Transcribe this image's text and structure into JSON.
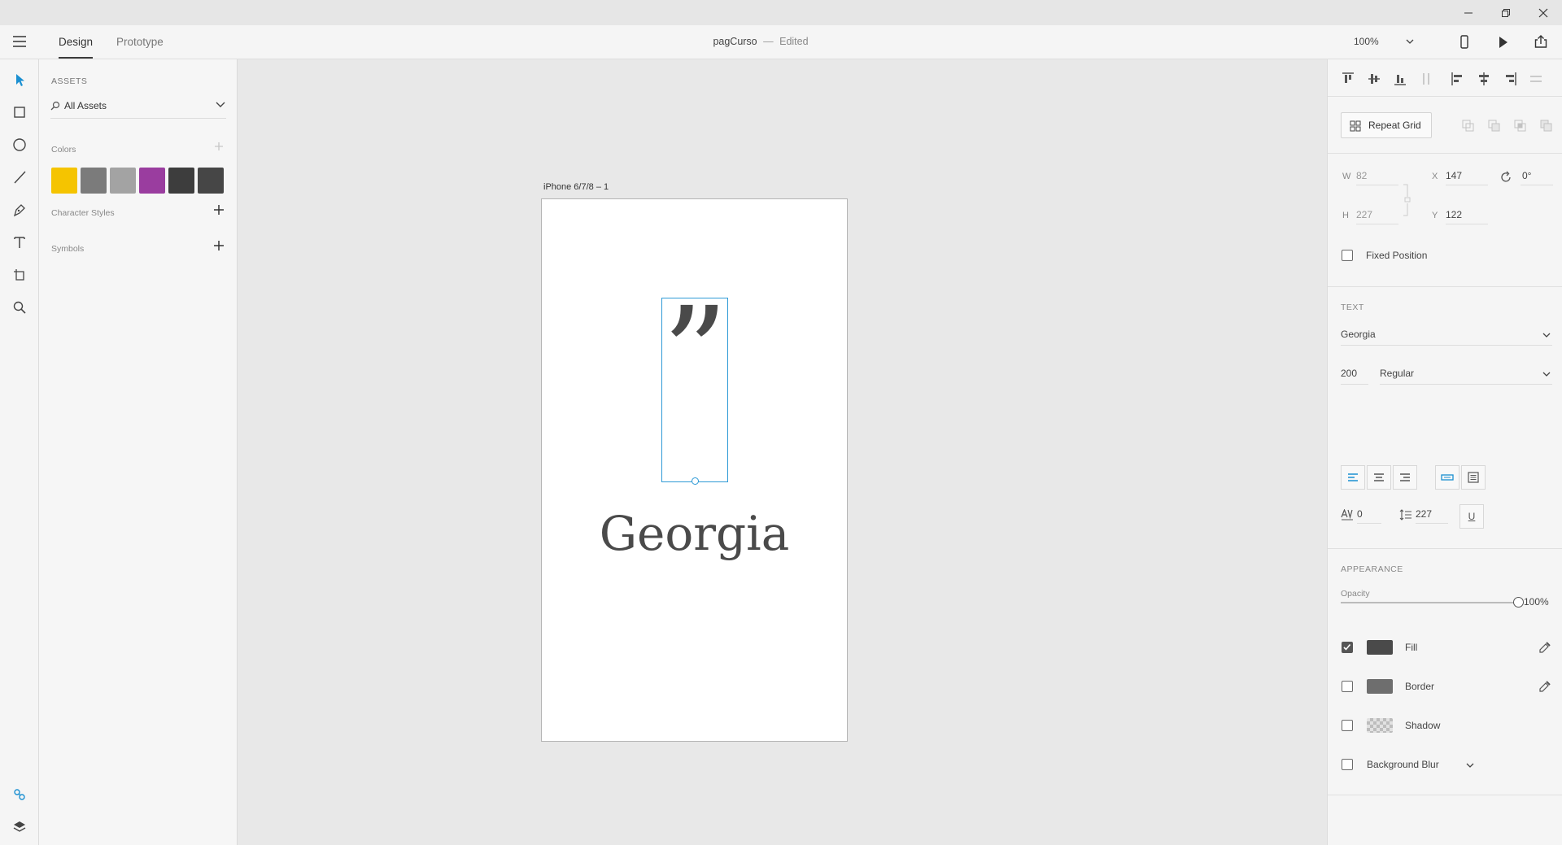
{
  "window": {
    "minimize_glyph": "—",
    "restore_glyph": "❐",
    "close_glyph": "✕"
  },
  "appbar": {
    "tabs": [
      {
        "label": "Design"
      },
      {
        "label": "Prototype"
      }
    ],
    "doc_title": "pagCurso",
    "doc_sep": "—",
    "doc_status": "Edited",
    "zoom": "100%"
  },
  "assets": {
    "heading": "ASSETS",
    "filter_label": "All Assets",
    "colors_label": "Colors",
    "colors": [
      "#f5c400",
      "#7b7b7b",
      "#a3a3a3",
      "#9a3d9f",
      "#3d3d3d",
      "#464646"
    ],
    "character_styles_label": "Character Styles",
    "symbols_label": "Symbols"
  },
  "canvas": {
    "artboard_name": "iPhone 6/7/8 – 1",
    "quote_glyph": "”",
    "sample_text": "Georgia"
  },
  "inspector": {
    "repeat_grid_label": "Repeat Grid",
    "w_label": "W",
    "w_value": "82",
    "h_label": "H",
    "h_value": "227",
    "x_label": "X",
    "x_value": "147",
    "y_label": "Y",
    "y_value": "122",
    "rotation_value": "0°",
    "fixed_position_label": "Fixed Position",
    "text_heading": "TEXT",
    "font_family": "Georgia",
    "font_size": "200",
    "font_weight": "Regular",
    "char_spacing": "0",
    "line_spacing": "227",
    "underline_glyph": "U",
    "appearance_heading": "APPEARANCE",
    "opacity_label": "Opacity",
    "opacity_value": "100%",
    "opacity_level": 1.0,
    "fill_label": "Fill",
    "fill_color": "#4a4a4a",
    "fill_checked": true,
    "border_label": "Border",
    "border_color": "#6e6e6e",
    "border_checked": false,
    "shadow_label": "Shadow",
    "shadow_checked": false,
    "blur_label": "Background Blur",
    "blur_checked": false
  }
}
